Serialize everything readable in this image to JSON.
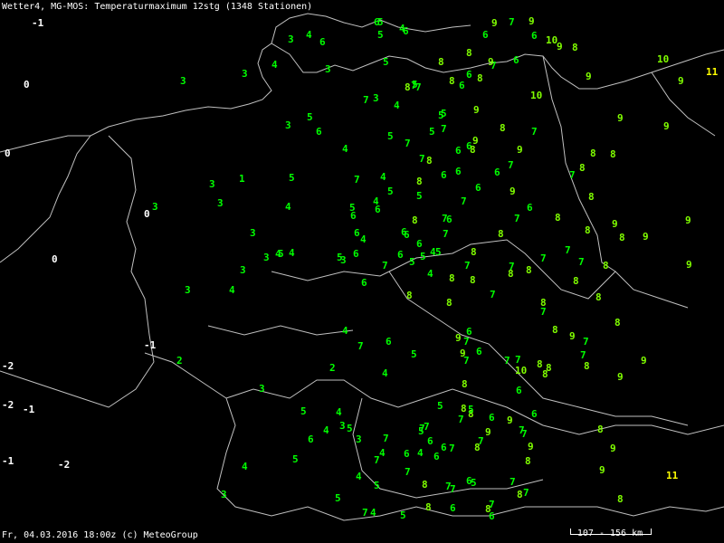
{
  "header": {
    "title": "Wetter4, MG-MOS: Temperaturmaximum 12stg (1348 Stationen)"
  },
  "footer": {
    "timestamp": "Fr, 04.03.2016 18:00z (c) MeteoGroup"
  },
  "scale": {
    "label": "107 - 156 km"
  },
  "colors": {
    "background": "#000000",
    "borders": "#c0c0c0",
    "cold": "#ffffff",
    "cool": "#00ff00",
    "mild": "#80ff00",
    "warm": "#ffff00"
  },
  "stations": [
    {
      "v": 6,
      "c": "cool"
    },
    {
      "v": 5,
      "c": "cool"
    },
    {
      "v": 5,
      "c": "cool"
    },
    {
      "v": 5,
      "c": "cool"
    },
    {
      "v": 5,
      "c": "cool"
    },
    {
      "v": 6,
      "c": "cool"
    },
    {
      "v": 5,
      "c": "cool"
    },
    {
      "v": 5,
      "c": "cool"
    },
    {
      "v": 5,
      "c": "cool"
    },
    {
      "v": 3,
      "c": "cool"
    },
    {
      "v": 5,
      "c": "cool"
    },
    {
      "v": 4,
      "c": "cool"
    },
    {
      "v": 3,
      "c": "cool"
    },
    {
      "v": 4,
      "c": "cool"
    },
    {
      "v": 3,
      "c": "cool"
    },
    {
      "v": 4,
      "c": "cool"
    },
    {
      "v": 5,
      "c": "cool"
    },
    {
      "v": 3,
      "c": "cool"
    },
    {
      "v": 4,
      "c": "cool"
    },
    {
      "v": 5,
      "c": "cool"
    },
    {
      "v": 6,
      "c": "cool"
    },
    {
      "v": 6,
      "c": "cool"
    },
    {
      "v": 6,
      "c": "cool"
    },
    {
      "v": 6,
      "c": "cool"
    },
    {
      "v": 7,
      "c": "cool"
    },
    {
      "v": 7,
      "c": "cool"
    },
    {
      "v": 6,
      "c": "cool"
    },
    {
      "v": 7,
      "c": "cool"
    },
    {
      "v": 7,
      "c": "cool"
    },
    {
      "v": 6,
      "c": "cool"
    },
    {
      "v": 7,
      "c": "cool"
    },
    {
      "v": 7,
      "c": "cool"
    },
    {
      "v": 7,
      "c": "cool"
    },
    {
      "v": 8,
      "c": "mild"
    },
    {
      "v": 7,
      "c": "cool"
    },
    {
      "v": 7,
      "c": "cool"
    },
    {
      "v": 8,
      "c": "mild"
    },
    {
      "v": 8,
      "c": "mild"
    },
    {
      "v": 8,
      "c": "mild"
    },
    {
      "v": 7,
      "c": "cool"
    },
    {
      "v": 8,
      "c": "mild"
    },
    {
      "v": 8,
      "c": "mild"
    },
    {
      "v": 8,
      "c": "mild"
    },
    {
      "v": 9,
      "c": "mild"
    },
    {
      "v": 8,
      "c": "mild"
    },
    {
      "v": 9,
      "c": "mild"
    },
    {
      "v": 8,
      "c": "mild"
    },
    {
      "v": 9,
      "c": "mild"
    },
    {
      "v": 8,
      "c": "mild"
    },
    {
      "v": 9,
      "c": "mild"
    },
    {
      "v": 8,
      "c": "mild"
    },
    {
      "v": 8,
      "c": "mild"
    },
    {
      "v": 9,
      "c": "mild"
    },
    {
      "v": 7,
      "c": "cool"
    },
    {
      "v": 8,
      "c": "mild"
    },
    {
      "v": 9,
      "c": "mild"
    },
    {
      "v": 8,
      "c": "mild"
    },
    {
      "v": 7,
      "c": "cool"
    },
    {
      "v": 7,
      "c": "cool"
    },
    {
      "v": 6,
      "c": "cool"
    },
    {
      "v": 6,
      "c": "cool"
    },
    {
      "v": 6,
      "c": "cool"
    },
    {
      "v": 6,
      "c": "cool"
    },
    {
      "v": 7,
      "c": "cool"
    },
    {
      "v": 5,
      "c": "cool"
    },
    {
      "v": 4,
      "c": "cool"
    },
    {
      "v": 5,
      "c": "cool"
    },
    {
      "v": 3,
      "c": "cool"
    },
    {
      "v": 4,
      "c": "cool"
    },
    {
      "v": 2,
      "c": "cool"
    },
    {
      "v": 4,
      "c": "cool"
    },
    {
      "v": 3,
      "c": "cool"
    },
    {
      "v": 4,
      "c": "cool"
    },
    {
      "v": 2,
      "c": "cool"
    },
    {
      "v": 4,
      "c": "cool"
    },
    {
      "v": 1,
      "c": "cool"
    },
    {
      "v": 3,
      "c": "cool"
    },
    {
      "v": -1,
      "c": "cold"
    },
    {
      "v": -1,
      "c": "cold"
    },
    {
      "v": 0,
      "c": "cold"
    },
    {
      "v": 0,
      "c": "cold"
    },
    {
      "v": 3,
      "c": "cool"
    },
    {
      "v": 4,
      "c": "cool"
    },
    {
      "v": 5,
      "c": "cool"
    },
    {
      "v": 6,
      "c": "cool"
    },
    {
      "v": 7,
      "c": "cool"
    },
    {
      "v": 7,
      "c": "cool"
    },
    {
      "v": 8,
      "c": "mild"
    },
    {
      "v": 7,
      "c": "cool"
    },
    {
      "v": 7,
      "c": "cool"
    },
    {
      "v": 8,
      "c": "mild"
    },
    {
      "v": 7,
      "c": "cool"
    },
    {
      "v": 8,
      "c": "mild"
    },
    {
      "v": 8,
      "c": "mild"
    },
    {
      "v": 7,
      "c": "cool"
    },
    {
      "v": 7,
      "c": "cool"
    },
    {
      "v": 6,
      "c": "cool"
    },
    {
      "v": 7,
      "c": "cool"
    },
    {
      "v": 7,
      "c": "cool"
    },
    {
      "v": 6,
      "c": "cool"
    },
    {
      "v": 5,
      "c": "cool"
    },
    {
      "v": 6,
      "c": "cool"
    },
    {
      "v": 6,
      "c": "cool"
    },
    {
      "v": 5,
      "c": "cool"
    },
    {
      "v": 6,
      "c": "cool"
    },
    {
      "v": 8,
      "c": "mild"
    },
    {
      "v": 8,
      "c": "mild"
    },
    {
      "v": 7,
      "c": "cool"
    },
    {
      "v": 6,
      "c": "cool"
    },
    {
      "v": 5,
      "c": "cool"
    },
    {
      "v": 4,
      "c": "cool"
    },
    {
      "v": 3,
      "c": "cool"
    },
    {
      "v": 4,
      "c": "cool"
    },
    {
      "v": 5,
      "c": "cool"
    },
    {
      "v": -2,
      "c": "cold"
    },
    {
      "v": -1,
      "c": "cold"
    },
    {
      "v": 4,
      "c": "cool"
    },
    {
      "v": 5,
      "c": "cool"
    },
    {
      "v": 6,
      "c": "cool"
    },
    {
      "v": 7,
      "c": "cool"
    },
    {
      "v": 7,
      "c": "cool"
    },
    {
      "v": 7,
      "c": "cool"
    },
    {
      "v": 8,
      "c": "mild"
    },
    {
      "v": 8,
      "c": "mild"
    },
    {
      "v": 7,
      "c": "cool"
    },
    {
      "v": 8,
      "c": "mild"
    },
    {
      "v": 9,
      "c": "mild"
    },
    {
      "v": 8,
      "c": "mild"
    },
    {
      "v": 9,
      "c": "mild"
    },
    {
      "v": 8,
      "c": "mild"
    },
    {
      "v": 7,
      "c": "cool"
    },
    {
      "v": 8,
      "c": "mild"
    },
    {
      "v": 9,
      "c": "mild"
    },
    {
      "v": 7,
      "c": "cool"
    },
    {
      "v": 8,
      "c": "mild"
    },
    {
      "v": 9,
      "c": "mild"
    },
    {
      "v": 10,
      "c": "mild"
    },
    {
      "v": 8,
      "c": "mild"
    },
    {
      "v": 9,
      "c": "mild"
    },
    {
      "v": 9,
      "c": "mild"
    },
    {
      "v": 9,
      "c": "mild"
    },
    {
      "v": 8,
      "c": "mild"
    },
    {
      "v": 8,
      "c": "mild"
    },
    {
      "v": 7,
      "c": "cool"
    },
    {
      "v": 8,
      "c": "mild"
    },
    {
      "v": 7,
      "c": "cool"
    },
    {
      "v": 6,
      "c": "cool"
    },
    {
      "v": 5,
      "c": "cool"
    },
    {
      "v": 7,
      "c": "cool"
    },
    {
      "v": 6,
      "c": "cool"
    },
    {
      "v": 7,
      "c": "cool"
    },
    {
      "v": 7,
      "c": "cool"
    },
    {
      "v": 8,
      "c": "mild"
    },
    {
      "v": 9,
      "c": "mild"
    },
    {
      "v": 8,
      "c": "mild"
    },
    {
      "v": 7,
      "c": "cool"
    },
    {
      "v": 8,
      "c": "mild"
    },
    {
      "v": 9,
      "c": "mild"
    },
    {
      "v": 8,
      "c": "mild"
    },
    {
      "v": 7,
      "c": "cool"
    },
    {
      "v": 6,
      "c": "cool"
    },
    {
      "v": 7,
      "c": "cool"
    },
    {
      "v": 7,
      "c": "cool"
    },
    {
      "v": 6,
      "c": "cool"
    },
    {
      "v": 8,
      "c": "mild"
    },
    {
      "v": 7,
      "c": "cool"
    },
    {
      "v": 7,
      "c": "cool"
    },
    {
      "v": 9,
      "c": "mild"
    },
    {
      "v": 10,
      "c": "mild"
    },
    {
      "v": 9,
      "c": "mild"
    },
    {
      "v": 9,
      "c": "mild"
    },
    {
      "v": 8,
      "c": "mild"
    },
    {
      "v": 6,
      "c": "cool"
    },
    {
      "v": 5,
      "c": "cool"
    },
    {
      "v": 7,
      "c": "cool"
    },
    {
      "v": 8,
      "c": "mild"
    },
    {
      "v": 6,
      "c": "cool"
    },
    {
      "v": 7,
      "c": "cool"
    },
    {
      "v": 6,
      "c": "cool"
    },
    {
      "v": 9,
      "c": "mild"
    },
    {
      "v": 8,
      "c": "mild"
    },
    {
      "v": 10,
      "c": "mild"
    },
    {
      "v": 9,
      "c": "mild"
    },
    {
      "v": 9,
      "c": "mild"
    },
    {
      "v": 8,
      "c": "mild"
    },
    {
      "v": 11,
      "c": "warm"
    },
    {
      "v": 11,
      "c": "warm"
    },
    {
      "v": 10,
      "c": "mild"
    },
    {
      "v": 9,
      "c": "mild"
    },
    {
      "v": 8,
      "c": "mild"
    },
    {
      "v": -2,
      "c": "cold"
    },
    {
      "v": -1,
      "c": "cold"
    },
    {
      "v": 0,
      "c": "cold"
    },
    {
      "v": -2,
      "c": "cold"
    },
    {
      "v": 0,
      "c": "cold"
    },
    {
      "v": 6,
      "c": "cool"
    },
    {
      "v": 6,
      "c": "cool"
    },
    {
      "v": 6,
      "c": "cool"
    },
    {
      "v": 6,
      "c": "cool"
    },
    {
      "v": 5,
      "c": "cool"
    },
    {
      "v": 5,
      "c": "cool"
    },
    {
      "v": 6,
      "c": "cool"
    },
    {
      "v": 5,
      "c": "cool"
    },
    {
      "v": 5,
      "c": "cool"
    },
    {
      "v": 4,
      "c": "cool"
    },
    {
      "v": 6,
      "c": "cool"
    },
    {
      "v": 6,
      "c": "cool"
    },
    {
      "v": 7,
      "c": "cool"
    },
    {
      "v": 5,
      "c": "cool"
    },
    {
      "v": 6,
      "c": "cool"
    },
    {
      "v": 4,
      "c": "cool"
    },
    {
      "v": 5,
      "c": "cool"
    },
    {
      "v": 3,
      "c": "cool"
    },
    {
      "v": 4,
      "c": "cool"
    },
    {
      "v": 3,
      "c": "cool"
    },
    {
      "v": 5,
      "c": "cool"
    },
    {
      "v": 7,
      "c": "cool"
    },
    {
      "v": 7,
      "c": "cool"
    },
    {
      "v": 8,
      "c": "mild"
    },
    {
      "v": 8,
      "c": "mild"
    },
    {
      "v": 9,
      "c": "mild"
    },
    {
      "v": 8,
      "c": "mild"
    },
    {
      "v": 8,
      "c": "mild"
    },
    {
      "v": 7,
      "c": "cool"
    },
    {
      "v": 8,
      "c": "mild"
    },
    {
      "v": 9,
      "c": "mild"
    },
    {
      "v": 9,
      "c": "mild"
    },
    {
      "v": 8,
      "c": "mild"
    },
    {
      "v": 9,
      "c": "mild"
    },
    {
      "v": 6,
      "c": "cool"
    },
    {
      "v": 6,
      "c": "cool"
    },
    {
      "v": 6,
      "c": "cool"
    },
    {
      "v": 5,
      "c": "cool"
    },
    {
      "v": 6,
      "c": "cool"
    },
    {
      "v": 6,
      "c": "cool"
    },
    {
      "v": 4,
      "c": "cool"
    },
    {
      "v": 3,
      "c": "cool"
    },
    {
      "v": 4,
      "c": "cool"
    },
    {
      "v": 4,
      "c": "cool"
    },
    {
      "v": 4,
      "c": "cool"
    },
    {
      "v": 3,
      "c": "cool"
    },
    {
      "v": 3,
      "c": "cool"
    },
    {
      "v": 3,
      "c": "cool"
    },
    {
      "v": 3,
      "c": "cool"
    },
    {
      "v": 3,
      "c": "cool"
    },
    {
      "v": 3,
      "c": "cool"
    },
    {
      "v": 4,
      "c": "cool"
    },
    {
      "v": 4,
      "c": "cool"
    },
    {
      "v": 5,
      "c": "cool"
    },
    {
      "v": 4,
      "c": "cool"
    }
  ]
}
